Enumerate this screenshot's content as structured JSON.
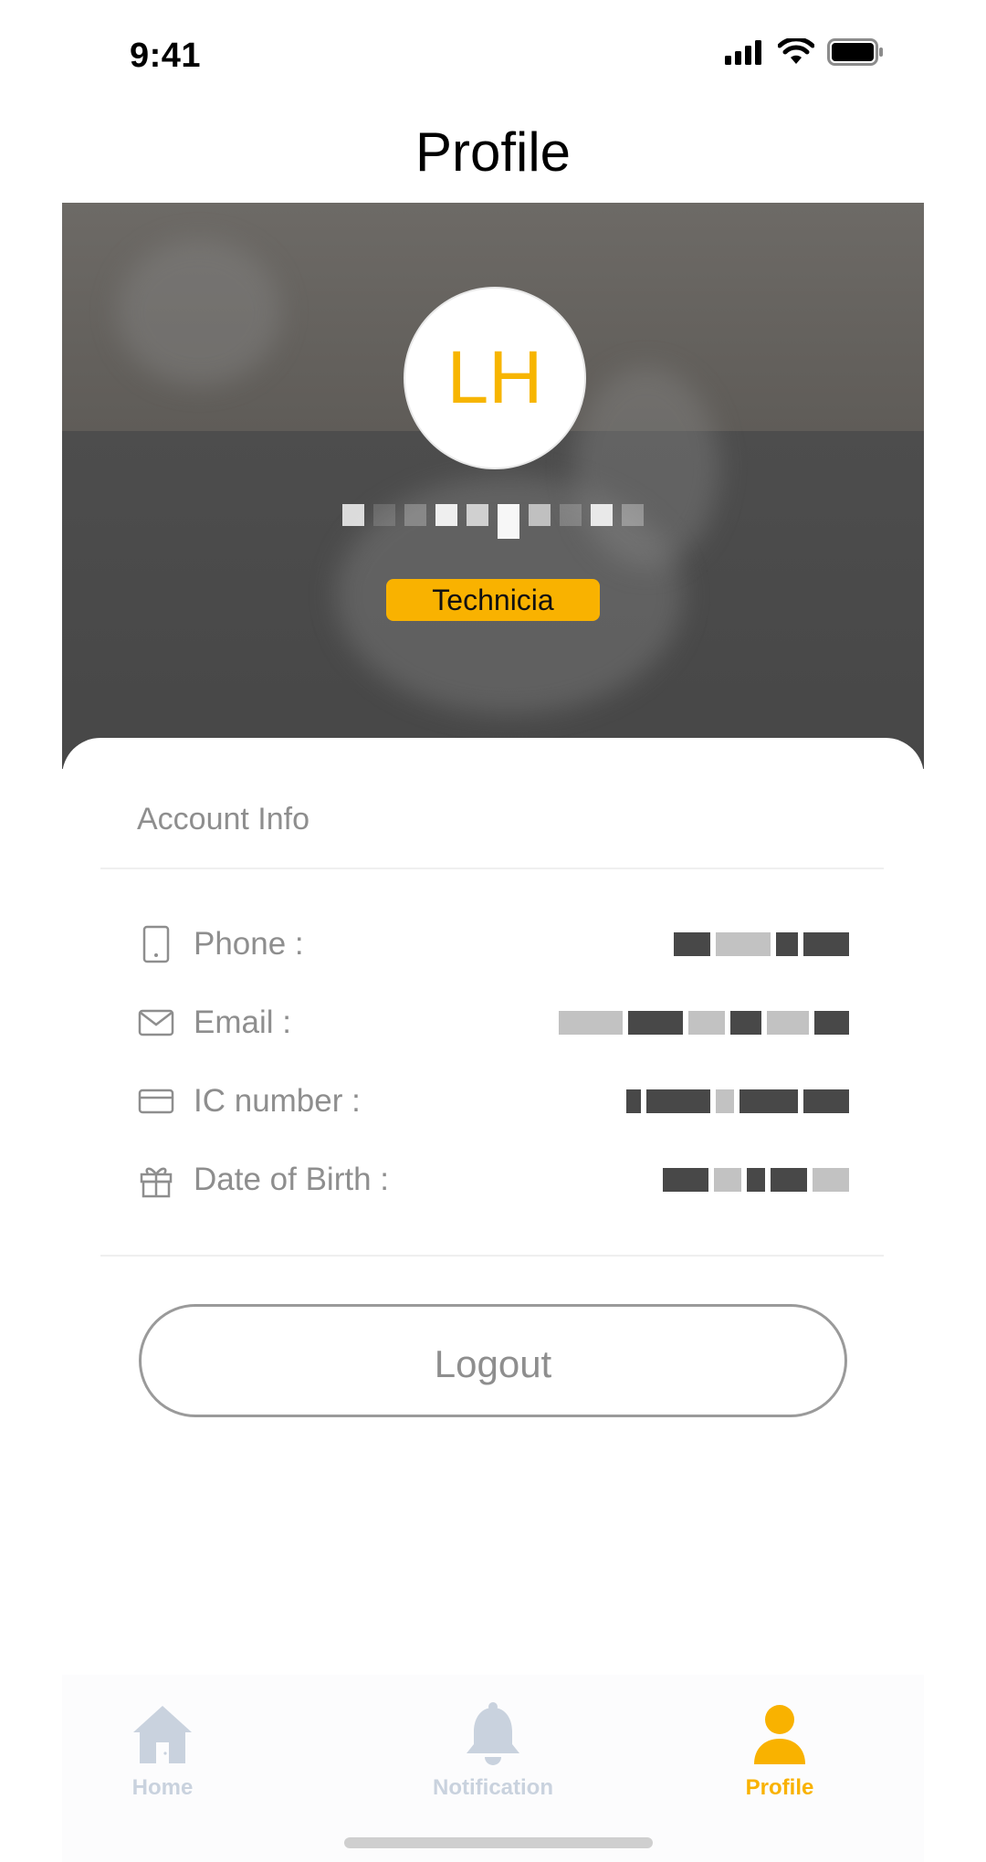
{
  "status_bar": {
    "time": "9:41"
  },
  "header": {
    "title": "Profile"
  },
  "profile": {
    "initials": "LH",
    "role": "Technicia"
  },
  "account_info": {
    "section_title": "Account Info",
    "rows": [
      {
        "icon": "phone-icon",
        "label": "Phone :"
      },
      {
        "icon": "mail-icon",
        "label": "Email :"
      },
      {
        "icon": "card-icon",
        "label": "IC number :"
      },
      {
        "icon": "gift-icon",
        "label": "Date of Birth :"
      }
    ]
  },
  "logout_label": "Logout",
  "tabbar": {
    "items": [
      {
        "label": "Home",
        "icon": "home-icon",
        "active": false
      },
      {
        "label": "Notification",
        "icon": "bell-icon",
        "active": false
      },
      {
        "label": "Profile",
        "icon": "person-icon",
        "active": true
      }
    ]
  },
  "colors": {
    "accent": "#F9B200",
    "inactive": "#C9D2DE",
    "muted_text": "#8E8E8E"
  }
}
